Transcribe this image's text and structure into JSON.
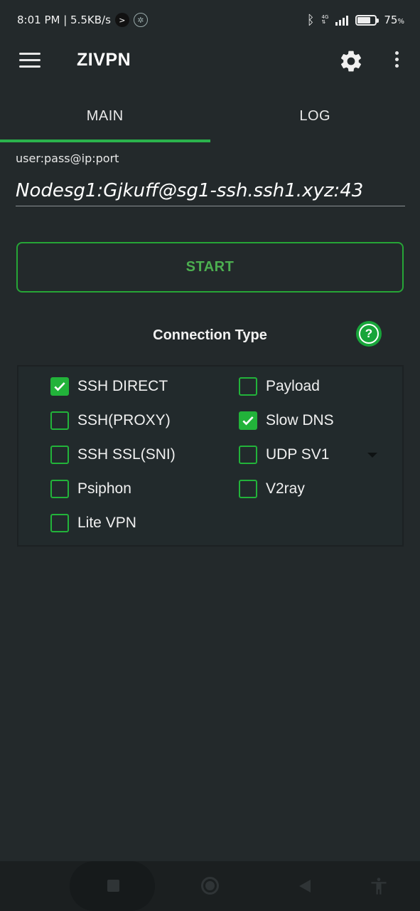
{
  "status_bar": {
    "time_speed": "8:01 PM | 5.5KB/s",
    "network_type": "4G",
    "battery": "75",
    "battery_fraction": 0.75
  },
  "app_bar": {
    "title": "ZIVPN",
    "icons": [
      "menu-icon",
      "gear-icon",
      "more-vert-icon"
    ]
  },
  "tabs": [
    {
      "label": "MAIN",
      "active": true
    },
    {
      "label": "LOG",
      "active": false
    }
  ],
  "server_field": {
    "label": "user:pass@ip:port",
    "value": "Nodesg1:Gjkuff@sg1-ssh.ssh1.xyz:43"
  },
  "start_button": {
    "label": "START"
  },
  "connection": {
    "title": "Connection Type",
    "options_left": [
      {
        "label": "SSH DIRECT",
        "checked": true
      },
      {
        "label": "SSH(PROXY)",
        "checked": false
      },
      {
        "label": "SSH SSL(SNI)",
        "checked": false
      },
      {
        "label": "Psiphon",
        "checked": false
      },
      {
        "label": "Lite VPN",
        "checked": false
      }
    ],
    "options_right": [
      {
        "label": "Payload",
        "checked": false
      },
      {
        "label": "Slow DNS",
        "checked": true
      },
      {
        "label": "UDP SV1",
        "checked": false
      },
      {
        "label": "V2ray",
        "checked": false
      }
    ]
  },
  "colors": {
    "background": "#23292b",
    "accent": "#22b33a",
    "start_text": "#4caf50"
  }
}
